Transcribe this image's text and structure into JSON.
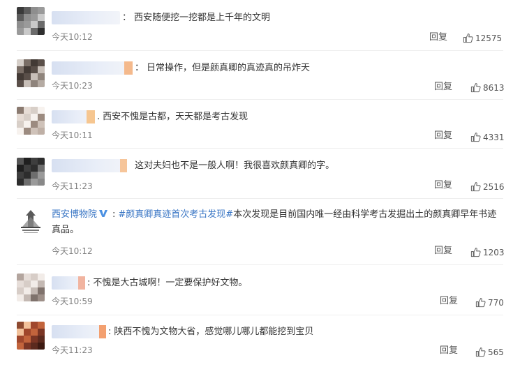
{
  "time_prefix": "今天",
  "reply_label": "回复",
  "colors": {
    "link": "#3b77c5",
    "text": "#333333",
    "meta": "#808080",
    "divider": "#eeeeee",
    "verified": "#4a90e2"
  },
  "comments": [
    {
      "text": "西安随便挖一挖都是上千年的文明",
      "time": "今天10:12",
      "likes": "12575"
    },
    {
      "text": "日常操作，但是颜真卿的真迹真的吊炸天",
      "time": "今天10:23",
      "likes": "8613"
    },
    {
      "text": "西安不愧是古都，天天都是考古发现",
      "time": "今天10:11",
      "likes": "4331"
    },
    {
      "text": "这对夫妇也不是一般人啊！我很喜欢颜真卿的字。",
      "time": "今天11:23",
      "likes": "2516"
    },
    {
      "name": "西安博物院",
      "verified": true,
      "topic": "#颜真卿真迹首次考古发现#",
      "text": "本次发现是目前国内唯一经由科学考古发掘出土的颜真卿早年书迹真品。",
      "time": "今天10:12",
      "likes": "1203"
    },
    {
      "text": "不愧是大古城啊！一定要保护好文物。",
      "time": "今天10:59",
      "likes": "770"
    },
    {
      "text": "陕西不愧为文物大省，感觉哪儿哪儿都能挖到宝贝",
      "time": "今天11:23",
      "likes": "565"
    }
  ]
}
